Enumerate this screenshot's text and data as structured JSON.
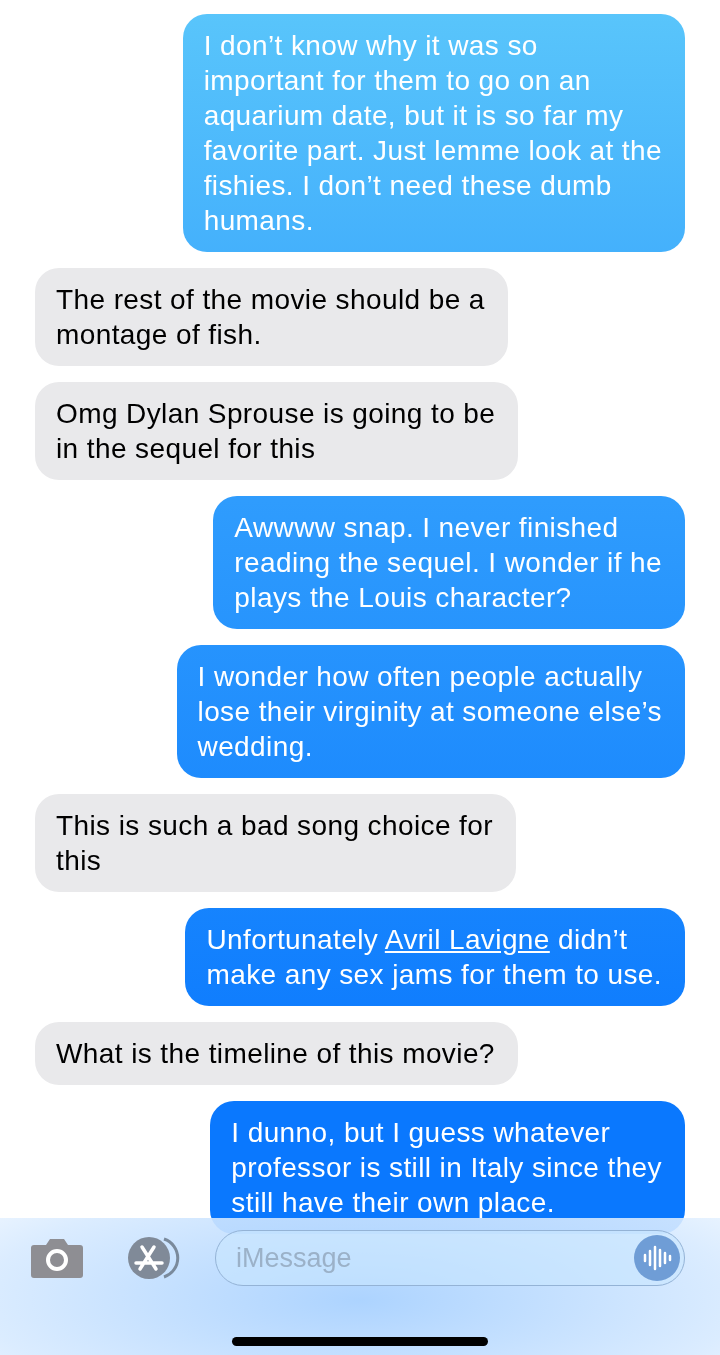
{
  "messages": [
    {
      "kind": "sent",
      "parts": [
        {
          "kind": "text",
          "text": "I don’t know why it was so\nimportant for them to go on an\naquarium date, but it is so far my\nfavorite part. Just lemme look at the\nfishies. I don’t need these dumb\nhumans."
        }
      ]
    },
    {
      "kind": "received",
      "parts": [
        {
          "kind": "text",
          "text": "The rest of the movie should be a\nmontage of fish."
        }
      ]
    },
    {
      "kind": "received",
      "parts": [
        {
          "kind": "text",
          "text": "Omg Dylan Sprouse is going to be\nin the sequel for this"
        }
      ]
    },
    {
      "kind": "sent",
      "parts": [
        {
          "kind": "text",
          "text": "Awwww snap. I never finished\nreading the sequel. I wonder if he\nplays the Louis character?"
        }
      ]
    },
    {
      "kind": "sent",
      "parts": [
        {
          "kind": "text",
          "text": "I wonder how often people actually\nlose their virginity at someone else’s\nwedding."
        }
      ]
    },
    {
      "kind": "received",
      "parts": [
        {
          "kind": "text",
          "text": "This is such a bad song choice for\nthis"
        }
      ]
    },
    {
      "kind": "sent",
      "parts": [
        {
          "kind": "text",
          "text": "Unfortunately "
        },
        {
          "kind": "link",
          "text": "Avril Lavigne"
        },
        {
          "kind": "text",
          "text": " didn’t\nmake any sex jams for them to use."
        }
      ]
    },
    {
      "kind": "received",
      "parts": [
        {
          "kind": "text",
          "text": "What is the timeline of this movie?"
        }
      ]
    },
    {
      "kind": "sent",
      "parts": [
        {
          "kind": "text",
          "text": "I dunno, but I guess whatever\nprofessor is still in Italy since they\nstill have their own place."
        }
      ]
    }
  ],
  "compose": {
    "placeholder": "iMessage"
  }
}
